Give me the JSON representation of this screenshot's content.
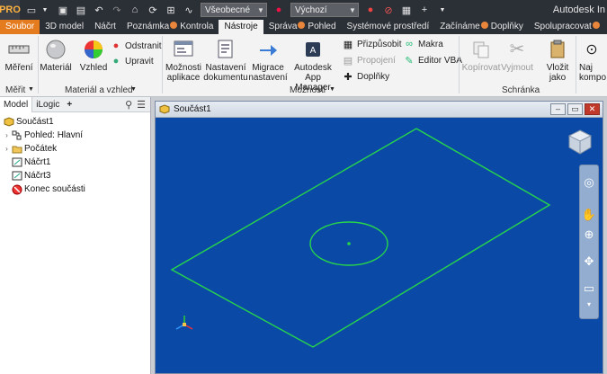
{
  "qat": {
    "logo": "PRO",
    "appearance_combo": "Všeobecné",
    "style_combo": "Výchozí",
    "app_title": "Autodesk In"
  },
  "tabs": [
    {
      "label": "Soubor"
    },
    {
      "label": "3D model"
    },
    {
      "label": "Náčrt"
    },
    {
      "label": "Poznámka"
    },
    {
      "label": "Kontrola"
    },
    {
      "label": "Nástroje"
    },
    {
      "label": "Správa"
    },
    {
      "label": "Pohled"
    },
    {
      "label": "Systémové prostředí"
    },
    {
      "label": "Začínáme"
    },
    {
      "label": "Doplňky"
    },
    {
      "label": "Spolupracovat"
    }
  ],
  "ribbon": {
    "measure": "Měření",
    "material": "Materiál",
    "appearance": "Vzhled",
    "remove": "Odstranit",
    "adjust": "Upravit",
    "app_options_1": "Možnosti",
    "app_options_2": "aplikace",
    "doc_settings_1": "Nastavení",
    "doc_settings_2": "dokumentu",
    "migrate_1": "Migrace",
    "migrate_2": "nastavení",
    "app_manager_1": "Autodesk",
    "app_manager_2": "App Manager",
    "customize": "Přizpůsobit",
    "macros": "Makra",
    "vba_editor": "Editor VBA",
    "properties": "Propojení",
    "addins": "Doplňky",
    "copy": "Kopírovat",
    "cut": "Vyjmout",
    "paste_1": "Vložit",
    "paste_2": "jako",
    "find_1": "Naj",
    "find_2": "kompo",
    "panel_measure": "Měřit",
    "panel_material": "Materiál a vzhled",
    "panel_options": "Možnosti",
    "panel_clipboard": "Schránka"
  },
  "browser": {
    "tab_model": "Model",
    "tab_ilogic": "iLogic",
    "add": "+",
    "tree": [
      {
        "label": "Součást1"
      },
      {
        "label": "Pohled: Hlavní"
      },
      {
        "label": "Počátek"
      },
      {
        "label": "Náčrt1"
      },
      {
        "label": "Náčrt3"
      },
      {
        "label": "Konec součásti"
      }
    ]
  },
  "document": {
    "title": "Součást1"
  },
  "colors": {
    "viewport_bg": "#0a4aa6",
    "sketch_line": "#27d64a",
    "accent": "#e57b1f"
  }
}
